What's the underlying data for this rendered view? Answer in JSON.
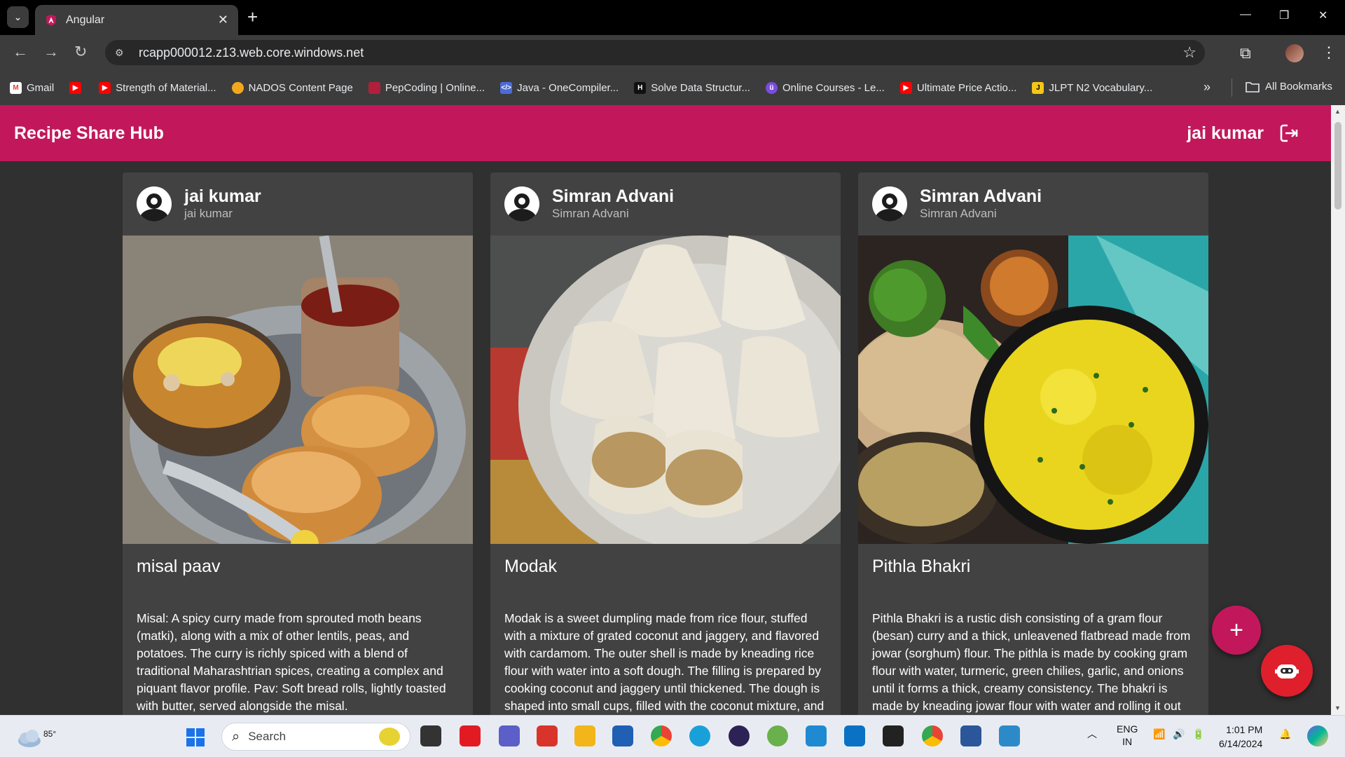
{
  "browser": {
    "tab_title": "Angular",
    "url": "rcapp000012.z13.web.core.windows.net",
    "bookmarks": [
      {
        "label": "Gmail",
        "color": "#ea4335"
      },
      {
        "label": "",
        "color": "#ff0000"
      },
      {
        "label": "Strength of Material...",
        "color": "#ff0000"
      },
      {
        "label": "NADOS Content Page",
        "color": "#f2a81d"
      },
      {
        "label": "PepCoding | Online...",
        "color": "#b21f3b"
      },
      {
        "label": "Java - OneCompiler...",
        "color": "#4b6cd8"
      },
      {
        "label": "Solve Data Structur...",
        "color": "#111111"
      },
      {
        "label": "Online Courses - Le...",
        "color": "#7b4ce0"
      },
      {
        "label": "Ultimate Price Actio...",
        "color": "#ff0000"
      },
      {
        "label": "JLPT N2 Vocabulary...",
        "color": "#f5c518"
      }
    ],
    "all_bookmarks": "All Bookmarks"
  },
  "app": {
    "title": "Recipe Share Hub",
    "user_name": "jai kumar",
    "accent": "#c2185b"
  },
  "cards": [
    {
      "author": "jai kumar",
      "author_sub": "jai kumar",
      "recipe": "misal paav",
      "description": "Misal: A spicy curry made from sprouted moth beans (matki), along with a mix of other lentils, peas, and potatoes. The curry is richly spiced with a blend of traditional Maharashtrian spices, creating a complex and piquant flavor profile. Pav: Soft bread rolls, lightly toasted with butter, served alongside the misal."
    },
    {
      "author": "Simran Advani",
      "author_sub": "Simran Advani",
      "recipe": "Modak",
      "description": "Modak is a sweet dumpling made from rice flour, stuffed with a mixture of grated coconut and jaggery, and flavored with cardamom. The outer shell is made by kneading rice flour with water into a soft dough. The filling is prepared by cooking coconut and jaggery until thickened. The dough is shaped into small cups, filled with the coconut mixture, and sealed into a modak"
    },
    {
      "author": "Simran Advani",
      "author_sub": "Simran Advani",
      "recipe": "Pithla Bhakri",
      "description": "Pithla Bhakri is a rustic dish consisting of a gram flour (besan) curry and a thick, unleavened flatbread made from jowar (sorghum) flour. The pithla is made by cooking gram flour with water, turmeric, green chilies, garlic, and onions until it forms a thick, creamy consistency. The bhakri is made by kneading jowar flour with water and rolling it out into discs, which are cooked"
    }
  ],
  "taskbar": {
    "temperature": "85°",
    "search_label": "Search",
    "lang_top": "ENG",
    "lang_bottom": "IN",
    "time": "1:01 PM",
    "date": "6/14/2024"
  }
}
